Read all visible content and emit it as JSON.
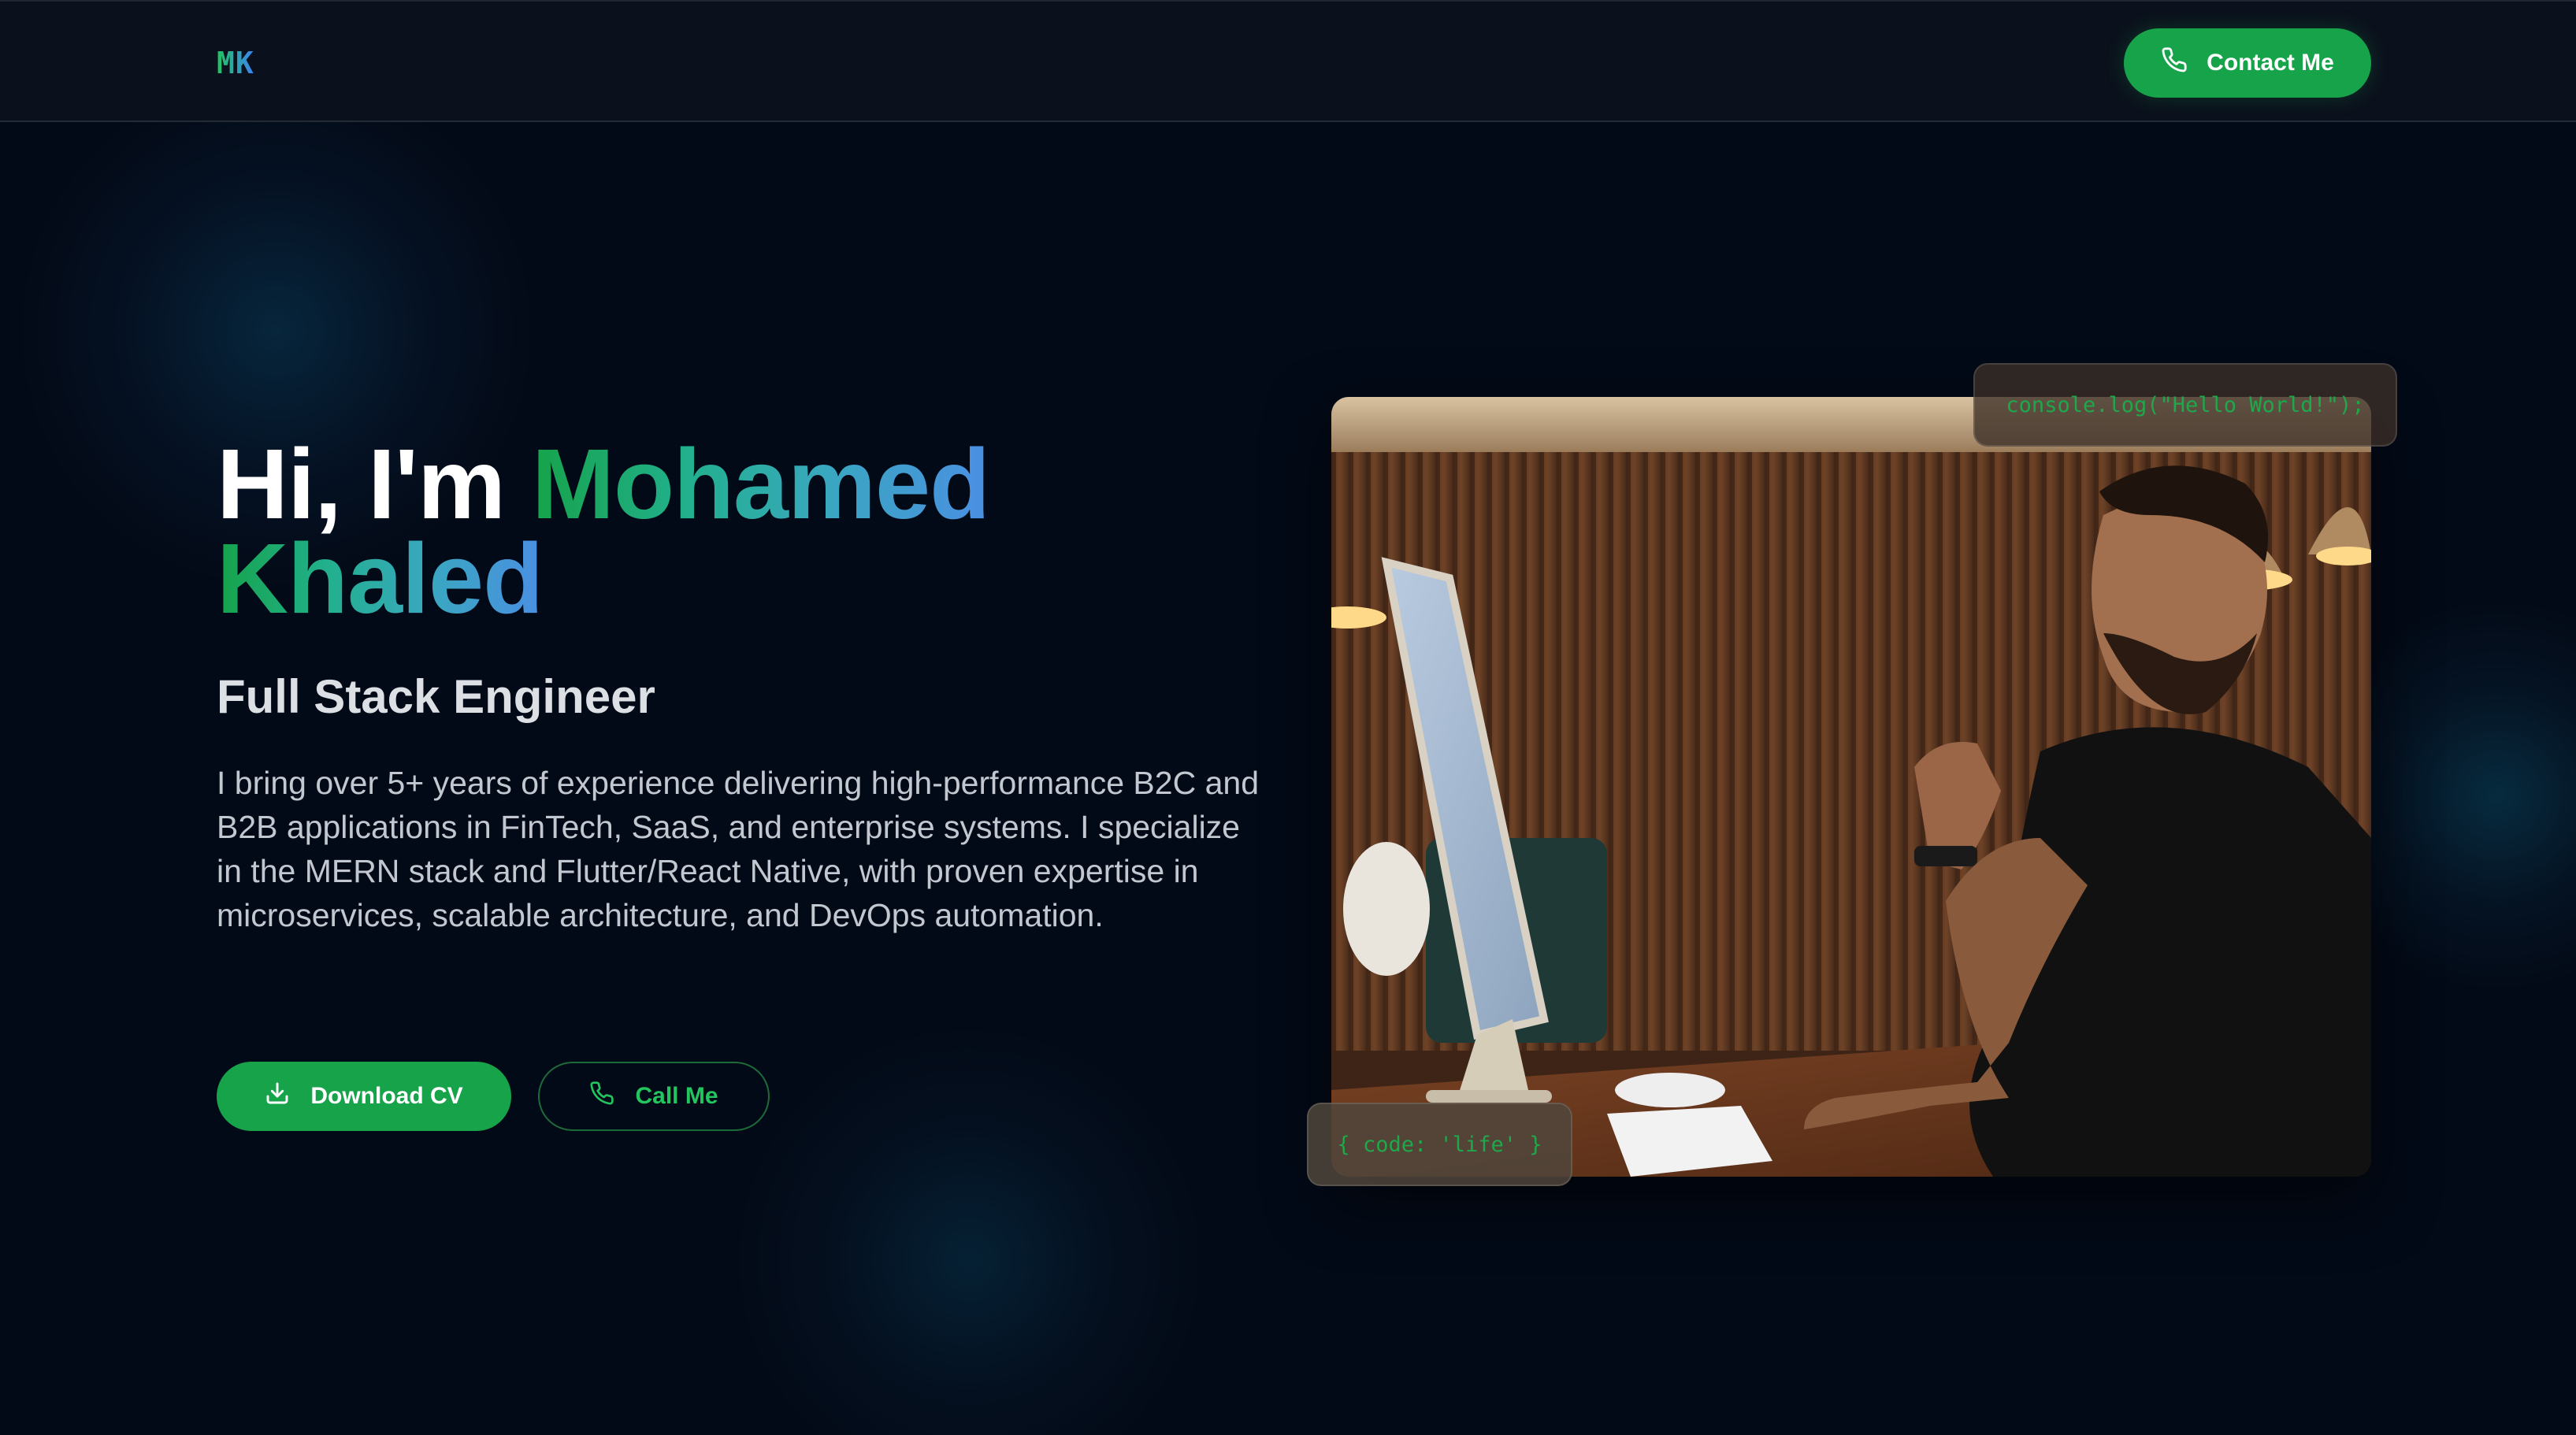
{
  "header": {
    "logo": "MK",
    "contact_button": "Contact Me"
  },
  "hero": {
    "greeting": "Hi, I'm ",
    "first_name": "Mohamed",
    "last_name": "Khaled",
    "role": "Full Stack Engineer",
    "bio": "I bring over 5+ years of experience delivering high-performance B2C and B2B applications in FinTech, SaaS, and enterprise systems. I specialize in the MERN stack and Flutter/React Native, with proven expertise in microservices, scalable architecture, and DevOps automation.",
    "download_cv_button": "Download CV",
    "call_me_button": "Call Me"
  },
  "visual": {
    "code_chip_top": "console.log(\"Hello World!\");",
    "code_chip_bottom": "{ code: 'life' }"
  },
  "icons": {
    "contact": "phone-icon",
    "download": "download-icon",
    "call": "phone-icon"
  },
  "colors": {
    "background": "#030a17",
    "header": "#0b111c",
    "accent_green": "#16a34a",
    "accent_blue": "#4a8fe3"
  }
}
